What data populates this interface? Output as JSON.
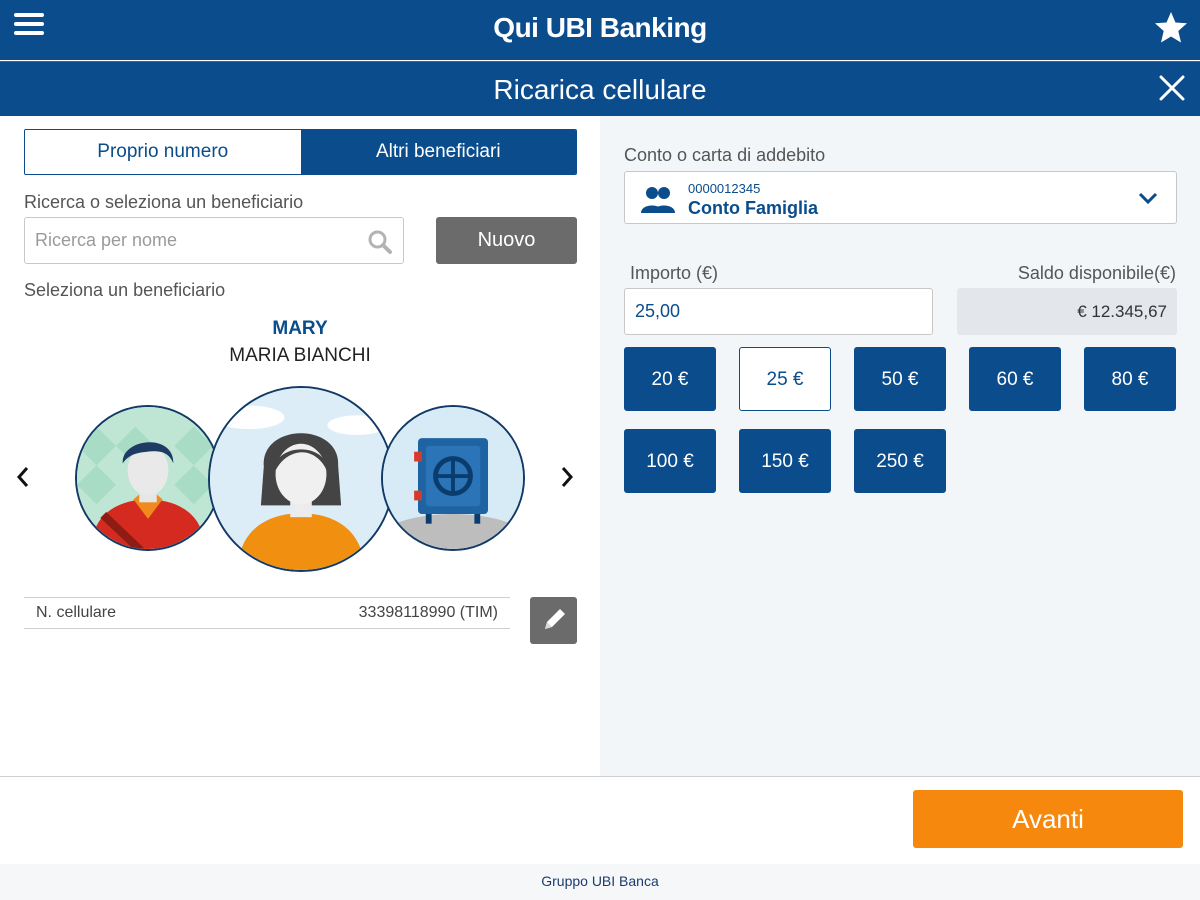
{
  "header": {
    "brand": "Qui UBI Banking",
    "title": "Ricarica cellulare",
    "menu_icon": "hamburger-menu-icon",
    "favorite_icon": "star-icon",
    "close_icon": "close-icon"
  },
  "left": {
    "tabs": [
      {
        "label": "Proprio numero",
        "active": false
      },
      {
        "label": "Altri beneficiari",
        "active": true
      }
    ],
    "search_label": "Ricerca o seleziona un beneficiario",
    "search_placeholder": "Ricerca per nome",
    "new_button": "Nuovo",
    "select_label": "Seleziona un beneficiario",
    "beneficiary": {
      "nickname": "MARY",
      "name": "MARIA BIANCHI"
    },
    "phone": {
      "label": "N. cellulare",
      "value": "33398118990 (TIM)"
    }
  },
  "right": {
    "account_label": "Conto o carta di addebito",
    "account": {
      "number": "0000012345",
      "name": "Conto Famiglia"
    },
    "amount_label": "Importo (€)",
    "amount_value": "25,00",
    "balance_label": "Saldo disponibile(€)",
    "balance_value": "€ 12.345,67",
    "amounts": [
      "20 €",
      "25 €",
      "50 €",
      "60 €",
      "80 €",
      "100 €",
      "150 €",
      "250 €"
    ],
    "selected_amount": "25 €"
  },
  "footer": {
    "next_button": "Avanti",
    "group_brand": "Gruppo UBI Banca"
  },
  "colors": {
    "primary": "#0a4c8c",
    "accent": "#f5880d",
    "neutral_button": "#6b6b6b"
  }
}
